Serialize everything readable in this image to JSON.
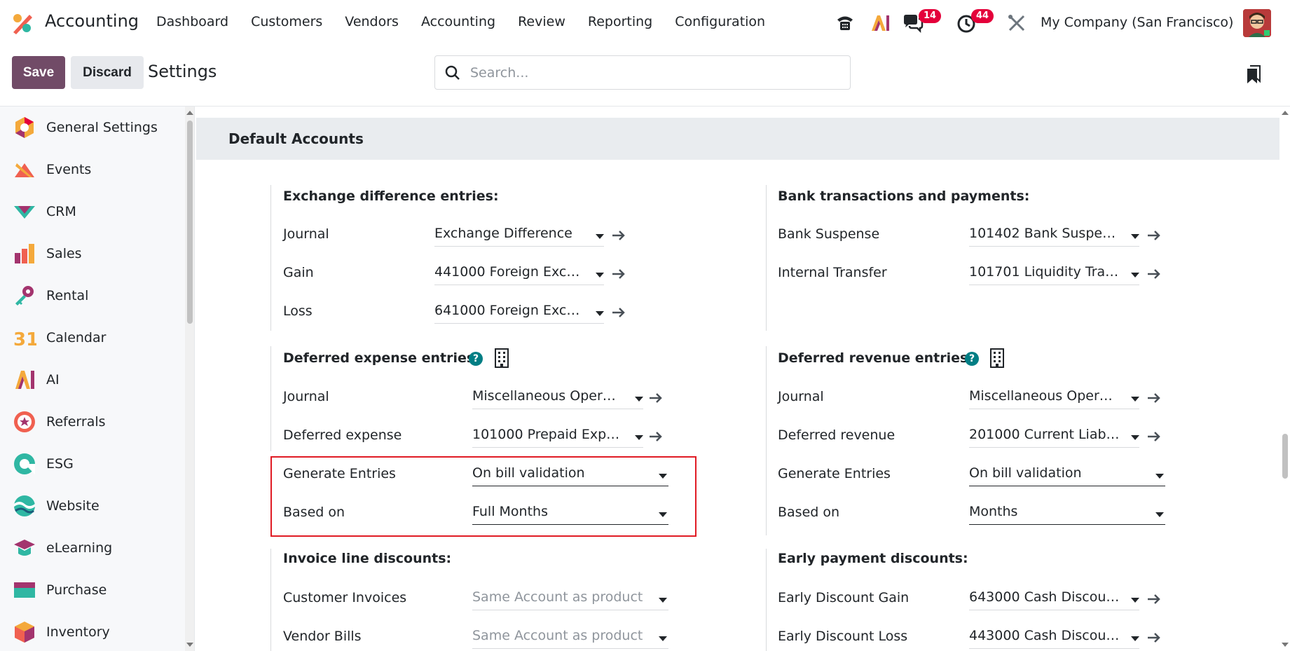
{
  "app": {
    "name": "Accounting",
    "company": "My Company (San Francisco)"
  },
  "menu": [
    "Dashboard",
    "Customers",
    "Vendors",
    "Accounting",
    "Review",
    "Reporting",
    "Configuration"
  ],
  "badges": {
    "messages": "14",
    "activities": "44"
  },
  "toolbar": {
    "save_label": "Save",
    "discard_label": "Discard",
    "title": "Settings"
  },
  "search": {
    "placeholder": "Search..."
  },
  "sidebar": {
    "items": [
      {
        "label": "General Settings",
        "icon": "general-settings-icon"
      },
      {
        "label": "Events",
        "icon": "events-icon"
      },
      {
        "label": "CRM",
        "icon": "crm-icon"
      },
      {
        "label": "Sales",
        "icon": "sales-icon"
      },
      {
        "label": "Rental",
        "icon": "rental-icon"
      },
      {
        "label": "Calendar",
        "icon": "calendar-icon"
      },
      {
        "label": "AI",
        "icon": "ai-icon"
      },
      {
        "label": "Referrals",
        "icon": "referrals-icon"
      },
      {
        "label": "ESG",
        "icon": "esg-icon"
      },
      {
        "label": "Website",
        "icon": "website-icon"
      },
      {
        "label": "eLearning",
        "icon": "elearning-icon"
      },
      {
        "label": "Purchase",
        "icon": "purchase-icon"
      },
      {
        "label": "Inventory",
        "icon": "inventory-icon"
      }
    ],
    "calendar_icon_text": "31"
  },
  "section": {
    "title": "Default Accounts"
  },
  "exchange": {
    "title": "Exchange difference entries:",
    "journal_label": "Journal",
    "journal_value": "Exchange Difference",
    "gain_label": "Gain",
    "gain_value": "441000 Foreign Exch…",
    "loss_label": "Loss",
    "loss_value": "641000 Foreign Exch…"
  },
  "bank": {
    "title": "Bank transactions and payments:",
    "suspense_label": "Bank Suspense",
    "suspense_value": "101402 Bank Suspen…",
    "transfer_label": "Internal Transfer",
    "transfer_value": "101701 Liquidity Tra…"
  },
  "deferred_expense": {
    "title": "Deferred expense entries:",
    "help": "?",
    "journal_label": "Journal",
    "journal_value": "Miscellaneous Oper…",
    "account_label": "Deferred expense",
    "account_value": "101000 Prepaid Exp…",
    "generate_label": "Generate Entries",
    "generate_value": "On bill validation",
    "based_label": "Based on",
    "based_value": "Full Months"
  },
  "deferred_revenue": {
    "title": "Deferred revenue entries:",
    "help": "?",
    "journal_label": "Journal",
    "journal_value": "Miscellaneous Oper…",
    "account_label": "Deferred revenue",
    "account_value": "201000 Current Liab…",
    "generate_label": "Generate Entries",
    "generate_value": "On bill validation",
    "based_label": "Based on",
    "based_value": "Months"
  },
  "invoice_discounts": {
    "title": "Invoice line discounts:",
    "customer_label": "Customer Invoices",
    "customer_value": "Same Account as product",
    "vendor_label": "Vendor Bills",
    "vendor_value": "Same Account as product"
  },
  "early_discounts": {
    "title": "Early payment discounts:",
    "gain_label": "Early Discount Gain",
    "gain_value": "643000 Cash Discou…",
    "loss_label": "Early Discount Loss",
    "loss_value": "443000 Cash Discou…"
  },
  "colors": {
    "primary": "#714b67",
    "badge": "#e4003a",
    "help": "#017e84",
    "highlight": "#e01b24"
  }
}
